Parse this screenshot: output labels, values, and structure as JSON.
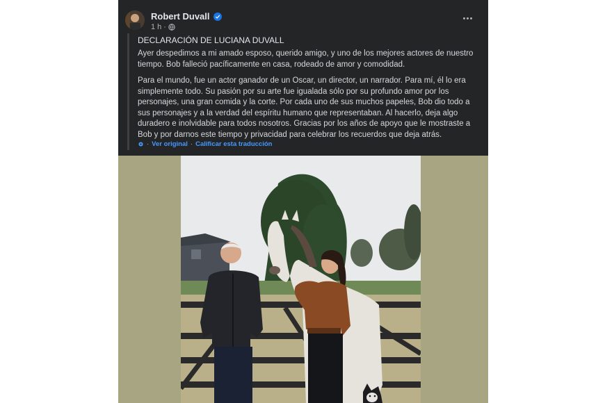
{
  "post": {
    "author": "Robert Duvall",
    "time": "1 h",
    "headline": "DECLARACIÓN DE LUCIANA DUVALL",
    "paragraphs": [
      "Ayer despedimos a mi amado esposo, querido amigo, y uno de los mejores actores de nuestro tiempo. Bob falleció pacíficamente en casa, rodeado de amor y comodidad.",
      "Para el mundo, fue un actor ganador de un Oscar, un director, un narrador. Para mí, él lo era simplemente todo. Su pasión por su arte fue igualada sólo por su profundo amor por los personajes, una gran comida y la corte. Por cada uno de sus muchos papeles, Bob dio todo a sus personajes y a la verdad del espíritu humano que representaban. Al hacerlo, deja algo duradero e inolvidable para todos nosotros. Gracias por los años de apoyo que le mostraste a Bob y por darnos este tiempo y privacidad para celebrar los recuerdos que deja atrás."
    ],
    "see_original": "Ver original",
    "rate_translation": "Calificar esta traducción",
    "separator": "·"
  },
  "icons": {
    "verified": "verified-badge-icon",
    "privacy": "globe-icon",
    "more": "more-options-icon",
    "translate": "translate-gear-icon"
  },
  "colors": {
    "card_bg": "#242526",
    "text_primary": "#e4e6eb",
    "text_secondary": "#b0b3b8",
    "link": "#4599ff",
    "verified": "#1b74e4",
    "photo_border": "#a8a582"
  }
}
